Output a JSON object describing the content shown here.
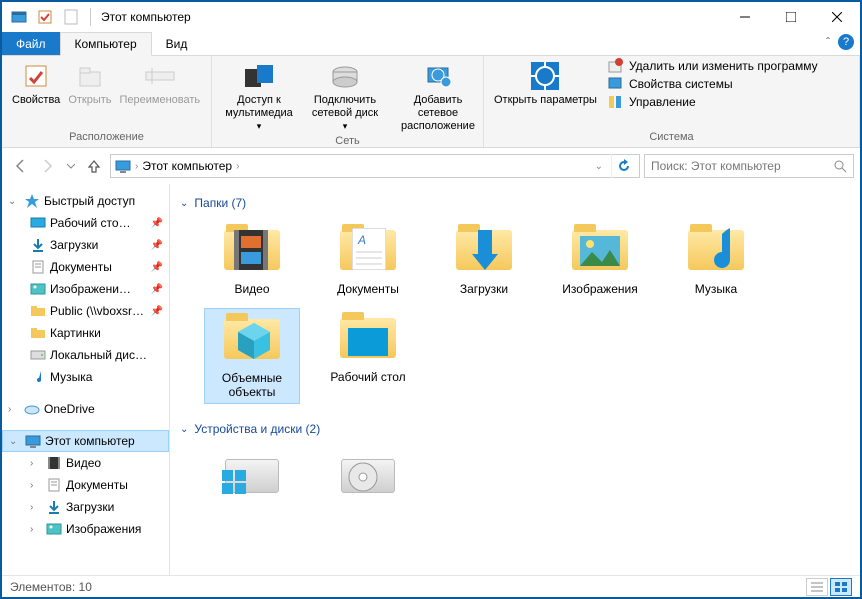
{
  "title": "Этот компьютер",
  "tabs": {
    "file": "Файл",
    "computer": "Компьютер",
    "view": "Вид"
  },
  "ribbon": {
    "groups": {
      "location": {
        "label": "Расположение",
        "props": "Свойства",
        "open": "Открыть",
        "rename": "Переименовать"
      },
      "network": {
        "label": "Сеть",
        "media": "Доступ к мультимедиа",
        "mapdrive": "Подключить сетевой диск",
        "addloc": "Добавить сетевое расположение"
      },
      "system": {
        "label": "Система",
        "openparams": "Открыть параметры",
        "uninstall": "Удалить или изменить программу",
        "sysprops": "Свойства системы",
        "manage": "Управление"
      }
    }
  },
  "breadcrumb": {
    "root": "Этот компьютер"
  },
  "search": {
    "placeholder": "Поиск: Этот компьютер"
  },
  "sidebar": {
    "quick": "Быстрый доступ",
    "items": [
      {
        "label": "Рабочий сто…",
        "pin": true,
        "icon": "desktop"
      },
      {
        "label": "Загрузки",
        "pin": true,
        "icon": "download"
      },
      {
        "label": "Документы",
        "pin": true,
        "icon": "document"
      },
      {
        "label": "Изображени…",
        "pin": true,
        "icon": "picture"
      },
      {
        "label": "Public (\\\\vboxsr…",
        "pin": true,
        "icon": "netfolder"
      },
      {
        "label": "Картинки",
        "pin": false,
        "icon": "folder"
      },
      {
        "label": "Локальный дис…",
        "pin": false,
        "icon": "drive"
      },
      {
        "label": "Музыка",
        "pin": false,
        "icon": "music"
      }
    ],
    "onedrive": "OneDrive",
    "thispc": "Этот компьютер",
    "pcitems": [
      {
        "label": "Видео",
        "icon": "video"
      },
      {
        "label": "Документы",
        "icon": "document"
      },
      {
        "label": "Загрузки",
        "icon": "download"
      },
      {
        "label": "Изображения",
        "icon": "picture"
      }
    ]
  },
  "sections": {
    "folders": {
      "title": "Папки (7)"
    },
    "drives": {
      "title": "Устройства и диски (2)"
    }
  },
  "folders": [
    {
      "label": "Видео",
      "icon": "video"
    },
    {
      "label": "Документы",
      "icon": "document"
    },
    {
      "label": "Загрузки",
      "icon": "download"
    },
    {
      "label": "Изображения",
      "icon": "picture"
    },
    {
      "label": "Музыка",
      "icon": "music"
    },
    {
      "label": "Объемные объекты",
      "icon": "3d",
      "selected": true
    },
    {
      "label": "Рабочий стол",
      "icon": "desktop"
    }
  ],
  "status": {
    "text": "Элементов: 10"
  }
}
